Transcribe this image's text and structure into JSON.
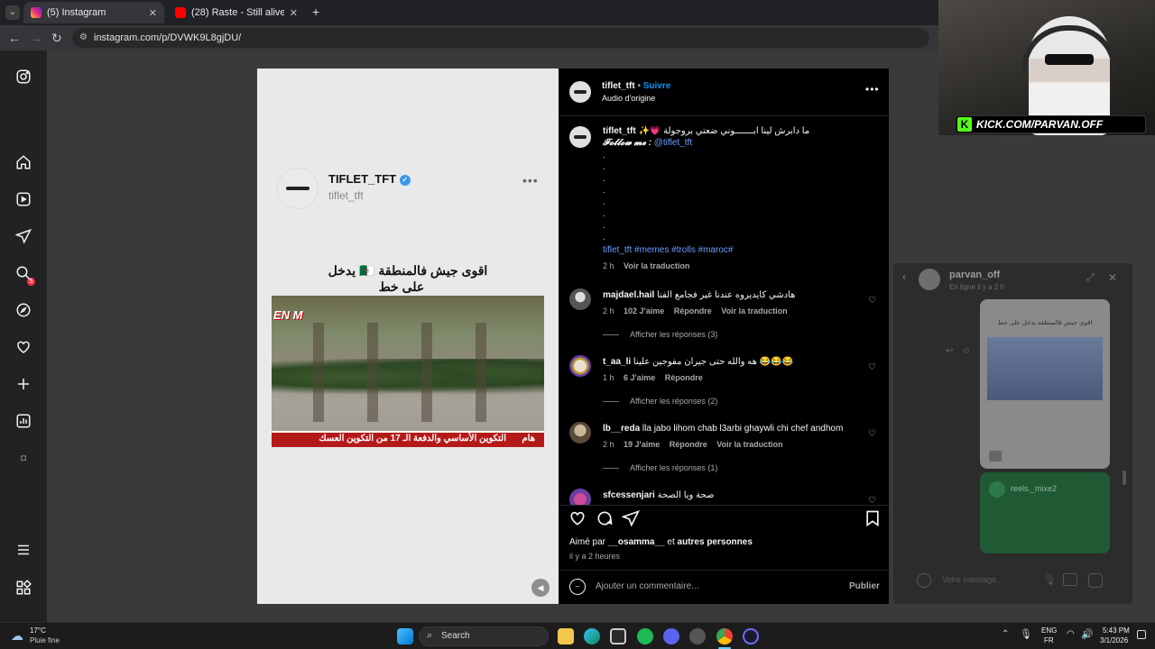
{
  "browser": {
    "tabs": [
      {
        "label": "(5) Instagram",
        "icon": "instagram-icon",
        "active": true,
        "color": "#e1306c"
      },
      {
        "label": "(28) Raste - Still alive (Official ly",
        "icon": "youtube-icon",
        "active": false,
        "color": "#ff0000"
      }
    ],
    "new_tab_label": "+",
    "url": "instagram.com/p/DVWK9L8gjDU/"
  },
  "sidebar": {
    "items": [
      "instagram-logo-icon",
      "home-icon",
      "reels-icon",
      "messages-icon",
      "search-icon",
      "explore-icon",
      "notifications-icon",
      "create-icon",
      "dashboard-icon",
      "threads-icon",
      "more-icon",
      "meta-apps-icon"
    ],
    "notification_badge": "5"
  },
  "media": {
    "account_name": "TIFLET_TFT",
    "account_handle": "tiflet_tft",
    "caption_line1": "اقوى جيش فالمنطقة 🇩🇿 يدخل",
    "caption_line2": "على خط",
    "video_banner_text": "التكوين الأساسي والدفعة الـ 17 من التكوين العسك",
    "video_banner_tag": "هام",
    "logo_text": "EN M"
  },
  "panel": {
    "header_user": "tiflet_tft",
    "header_follow": "Suivre",
    "header_audio": "Audio d'origine",
    "caption_user": "tiflet_tft",
    "caption_text": "ما دابرش لينا ابـــــــوني ضعتي بروجولة",
    "caption_follow": "𝓕𝓸𝓵𝓵𝓸𝔀 𝓶𝓮 :",
    "caption_mention": "@tiflet_tft",
    "caption_tags": "tiflet_tft #memes #trolls #maroc#",
    "caption_time": "2 h",
    "caption_translate": "Voir la traduction",
    "comments": [
      {
        "user": "majdael.hail",
        "text": "هادشي كايديروه عندنا غير فجامع الفنا",
        "time": "2 h",
        "likes": "102 J'aime",
        "reply": "Répondre",
        "translate": "Voir la traduction",
        "replies": "Afficher les réponses (3)"
      },
      {
        "user": "t_aa_li",
        "text": "😂😂😂 هه والله حتى جيران مفوجين علينا",
        "time": "1 h",
        "likes": "6 J'aime",
        "reply": "Répondre",
        "translate": "",
        "replies": "Afficher les réponses (2)"
      },
      {
        "user": "lb__reda",
        "text": "lla jabo lihom chab l3arbi ghaywli chi chef andhom",
        "time": "2 h",
        "likes": "19 J'aime",
        "reply": "Répondre",
        "translate": "Voir la traduction",
        "replies": "Afficher les réponses (1)"
      },
      {
        "user": "sfcessenjari",
        "text": "صحة ويا الصحة",
        "time": "",
        "likes": "",
        "reply": "",
        "translate": "",
        "replies": ""
      }
    ],
    "liked_by_prefix": "Aimé par",
    "liked_by_user": "__osamma__",
    "liked_by_and": "et",
    "liked_by_others": "autres personnes",
    "post_time": "il y a 2 heures",
    "comment_placeholder": "Ajouter un commentaire...",
    "publish_label": "Publier"
  },
  "webcam": {
    "overlay_text": "KICK.COM/PARVAN.OFF",
    "overlay_k": "K"
  },
  "chat": {
    "user": "parvan_off",
    "status": "En ligne il y a 2 h",
    "shared_reel_user": "reels._mixe2",
    "shared_caption": "اقوى جيش فالمنطقة يدخل على خط",
    "message_placeholder": "Votre message..."
  },
  "taskbar": {
    "weather_temp": "17°C",
    "weather_desc": "Pluie fine",
    "search_label": "Search",
    "lang_top": "ENG",
    "lang_bottom": "FR",
    "time": "5:43 PM",
    "date": "3/1/2026"
  }
}
